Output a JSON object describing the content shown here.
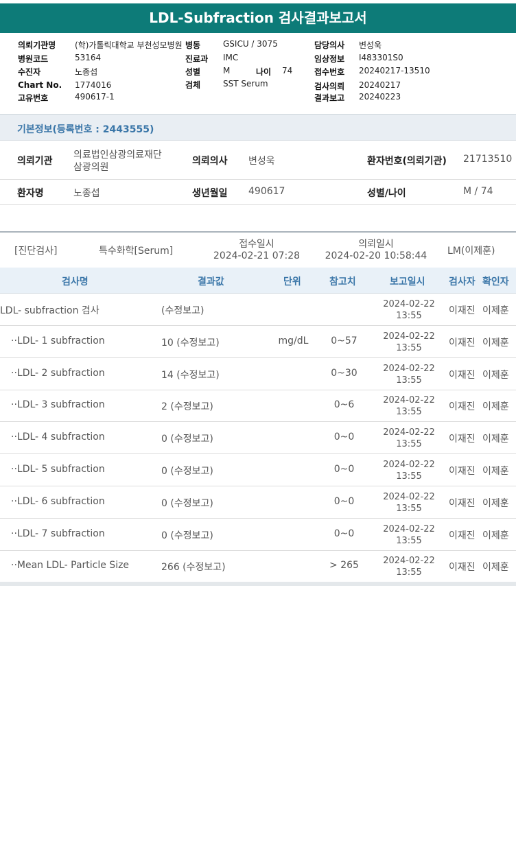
{
  "report": {
    "title": "LDL-Subfraction 검사결과보고서"
  },
  "header": {
    "labels": {
      "institution": "의뢰기관명",
      "hospital_code": "병원코드",
      "patient": "수진자",
      "chart": "Chart No.",
      "unique": "고유번호",
      "ward": "병동",
      "dept": "진료과",
      "sex": "성별",
      "age": "나이",
      "specimen": "검체",
      "doctor": "담당의사",
      "clinical": "임상정보",
      "receipt": "접수번호",
      "request": "검사의뢰",
      "report": "결과보고"
    },
    "values": {
      "institution": "(학)가톨릭대학교 부천성모병원",
      "hospital_code": "53164",
      "patient": "노종섭",
      "chart": "1774016",
      "unique": "490617-1",
      "ward": "GSICU / 3075",
      "dept": "IMC",
      "sex": "M",
      "age": "74",
      "specimen": "SST Serum",
      "doctor": "변성욱",
      "clinical": "I483301S0",
      "receipt": "20240217-13510",
      "request": "20240217",
      "report": "20240223"
    }
  },
  "basic_info": {
    "title": "기본정보(등록번호 : 2443555)",
    "labels": {
      "institution": "의뢰기관",
      "doctor": "의뢰의사",
      "patient_no": "환자번호(의뢰기관)",
      "name": "환자명",
      "birth": "생년월일",
      "sex_age": "성별/나이"
    },
    "values": {
      "institution_1": "의료법인삼광의료재단",
      "institution_2": "삼광의원",
      "doctor": "변성욱",
      "patient_no": "21713510",
      "name": "노종섭",
      "birth": "490617",
      "sex_age": "M / 74"
    }
  },
  "test_meta": {
    "category": "[진단검사]",
    "type": "특수화학[Serum]",
    "receipt_label": "접수일시",
    "receipt_dt": "2024-02-21 07:28",
    "request_label": "의뢰일시",
    "request_dt": "2024-02-20 10:58:44",
    "lm": "LM(이제훈)"
  },
  "table": {
    "headers": {
      "name": "검사명",
      "result": "결과값",
      "unit": "단위",
      "ref": "참고치",
      "report_dt": "보고일시",
      "tester": "검사자",
      "confirm": "확인자"
    },
    "rows": [
      {
        "name": "LDL- subfraction 검사",
        "result": "(수정보고)",
        "unit": "",
        "ref": "",
        "date": "2024-02-22",
        "time": "13:55",
        "tester": "이재진",
        "confirm": "이제훈"
      },
      {
        "name": "··LDL- 1 subfraction",
        "result": "10 (수정보고)",
        "unit": "mg/dL",
        "ref": "0~57",
        "date": "2024-02-22",
        "time": "13:55",
        "tester": "이재진",
        "confirm": "이제훈"
      },
      {
        "name": "··LDL- 2 subfraction",
        "result": "14 (수정보고)",
        "unit": "",
        "ref": "0~30",
        "date": "2024-02-22",
        "time": "13:55",
        "tester": "이재진",
        "confirm": "이제훈"
      },
      {
        "name": "··LDL- 3 subfraction",
        "result": "2 (수정보고)",
        "unit": "",
        "ref": "0~6",
        "date": "2024-02-22",
        "time": "13:55",
        "tester": "이재진",
        "confirm": "이제훈"
      },
      {
        "name": "··LDL- 4 subfraction",
        "result": "0 (수정보고)",
        "unit": "",
        "ref": "0~0",
        "date": "2024-02-22",
        "time": "13:55",
        "tester": "이재진",
        "confirm": "이제훈"
      },
      {
        "name": "··LDL- 5 subfraction",
        "result": "0 (수정보고)",
        "unit": "",
        "ref": "0~0",
        "date": "2024-02-22",
        "time": "13:55",
        "tester": "이재진",
        "confirm": "이제훈"
      },
      {
        "name": "··LDL- 6 subfraction",
        "result": "0 (수정보고)",
        "unit": "",
        "ref": "0~0",
        "date": "2024-02-22",
        "time": "13:55",
        "tester": "이재진",
        "confirm": "이제훈"
      },
      {
        "name": "··LDL- 7 subfraction",
        "result": "0 (수정보고)",
        "unit": "",
        "ref": "0~0",
        "date": "2024-02-22",
        "time": "13:55",
        "tester": "이재진",
        "confirm": "이제훈"
      },
      {
        "name": "··Mean LDL- Particle Size",
        "result": "266 (수정보고)",
        "unit": "",
        "ref": "> 265",
        "date": "2024-02-22",
        "time": "13:55",
        "tester": "이재진",
        "confirm": "이제훈"
      }
    ]
  }
}
